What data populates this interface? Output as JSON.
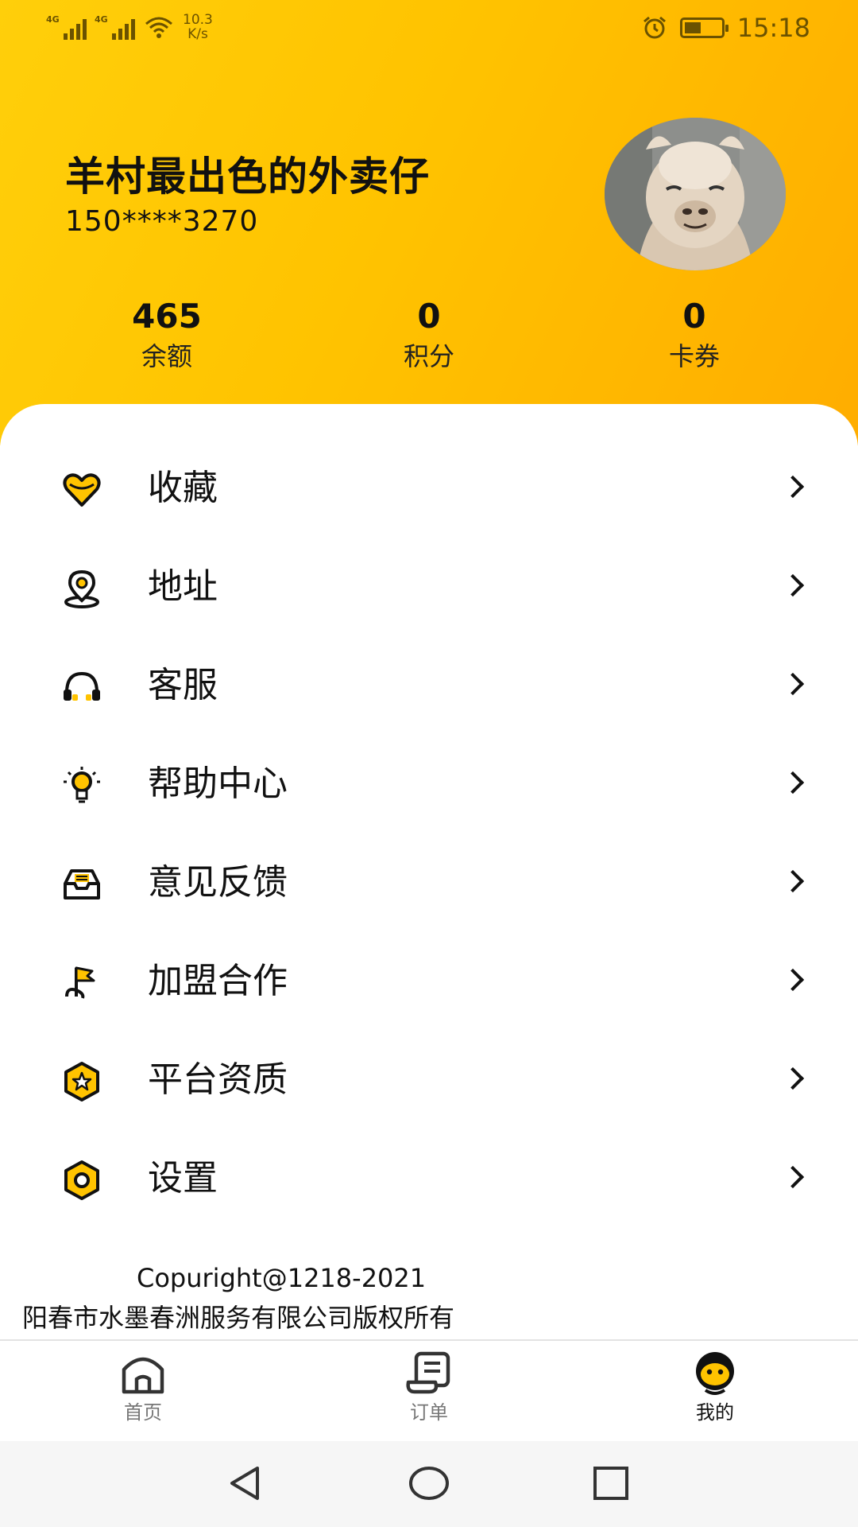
{
  "status_bar": {
    "network_left": "4G",
    "network_right": "4G",
    "speed_value": "10.3",
    "speed_unit": "K/s",
    "time": "15:18",
    "battery_level": 0.45
  },
  "profile": {
    "username": "羊村最出色的外卖仔",
    "phone": "150****3270",
    "avatar": "alpaca-photo"
  },
  "stats": [
    {
      "value": "465",
      "label": "余额"
    },
    {
      "value": "0",
      "label": "积分"
    },
    {
      "value": "0",
      "label": "卡券"
    }
  ],
  "menu": [
    {
      "label": "收藏",
      "icon": "heart-icon"
    },
    {
      "label": "地址",
      "icon": "location-pin-icon"
    },
    {
      "label": "客服",
      "icon": "headset-icon"
    },
    {
      "label": "帮助中心",
      "icon": "lightbulb-icon"
    },
    {
      "label": "意见反馈",
      "icon": "inbox-icon"
    },
    {
      "label": "加盟合作",
      "icon": "flag-icon"
    },
    {
      "label": "平台资质",
      "icon": "star-badge-icon"
    },
    {
      "label": "设置",
      "icon": "settings-hex-icon"
    }
  ],
  "footer": {
    "copyright": "Copuright@1218-2021",
    "company": "阳春市水墨春洲服务有限公司版权所有"
  },
  "tabbar": [
    {
      "label": "首页",
      "icon": "home-icon",
      "active": false
    },
    {
      "label": "订单",
      "icon": "order-scroll-icon",
      "active": false
    },
    {
      "label": "我的",
      "icon": "profile-face-icon",
      "active": true
    }
  ],
  "colors": {
    "accent": "#ffc300",
    "accent_dark": "#ffad00",
    "text": "#111111",
    "inactive": "#777777"
  }
}
